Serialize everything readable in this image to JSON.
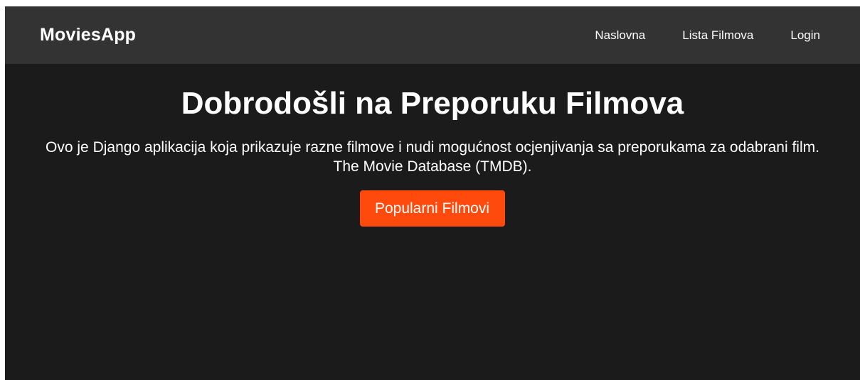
{
  "navbar": {
    "brand": "MoviesApp",
    "links": [
      "Naslovna",
      "Lista Filmova",
      "Login"
    ]
  },
  "hero": {
    "title": "Dobrodošli na Preporuku Filmova",
    "description": "Ovo je Django aplikacija koja prikazuje razne filmove i nudi mogućnost ocjenjivanja sa preporukama za odabrani film.",
    "note": "The Movie Database (TMDB).",
    "button_label": "Popularni Filmovi"
  },
  "colors": {
    "navbar_bg": "#333333",
    "page_bg": "#1b1b1b",
    "accent": "#ff4a0d",
    "text": "#ffffff"
  }
}
